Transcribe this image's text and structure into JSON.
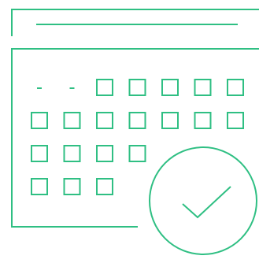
{
  "illustration": {
    "name": "calendar-check-illustration",
    "stroke_color": "#2fbf83",
    "background_color": "#ffffff",
    "calendar": {
      "grid_rows": [
        [
          "blank",
          "blank",
          "day",
          "day",
          "day",
          "day",
          "day"
        ],
        [
          "day",
          "day",
          "day",
          "day",
          "day",
          "day",
          "day"
        ],
        [
          "day",
          "day",
          "day",
          "day"
        ],
        [
          "day",
          "day",
          "day"
        ]
      ]
    },
    "badge": {
      "icon": "checkmark-icon"
    }
  }
}
